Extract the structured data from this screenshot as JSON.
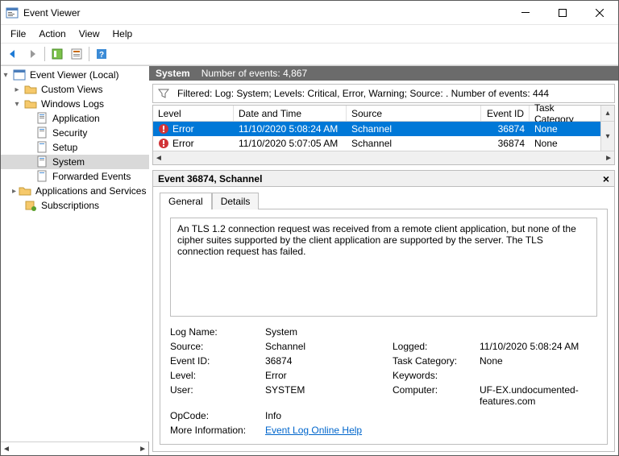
{
  "window": {
    "title": "Event Viewer"
  },
  "menu": {
    "file": "File",
    "action": "Action",
    "view": "View",
    "help": "Help"
  },
  "tree": {
    "root": "Event Viewer (Local)",
    "custom_views": "Custom Views",
    "windows_logs": "Windows Logs",
    "application": "Application",
    "security": "Security",
    "setup": "Setup",
    "system": "System",
    "forwarded": "Forwarded Events",
    "apps_logs": "Applications and Services Lo",
    "subscriptions": "Subscriptions"
  },
  "section": {
    "name": "System",
    "count_label": "Number of events: 4,867"
  },
  "filter_text": "Filtered: Log: System; Levels: Critical, Error, Warning; Source: . Number of events: 444",
  "table": {
    "headers": {
      "level": "Level",
      "date": "Date and Time",
      "source": "Source",
      "event_id": "Event ID",
      "task_cat": "Task Category"
    },
    "rows": [
      {
        "level": "Error",
        "date": "11/10/2020 5:08:24 AM",
        "source": "Schannel",
        "event_id": "36874",
        "task_cat": "None",
        "selected": true
      },
      {
        "level": "Error",
        "date": "11/10/2020 5:07:05 AM",
        "source": "Schannel",
        "event_id": "36874",
        "task_cat": "None",
        "selected": false
      }
    ]
  },
  "detail": {
    "title": "Event 36874, Schannel",
    "tabs": {
      "general": "General",
      "details": "Details"
    },
    "message": "An TLS 1.2 connection request was received from a remote client application, but none of the cipher suites supported by the client application are supported by the server. The TLS connection request has failed.",
    "labels": {
      "log_name": "Log Name:",
      "source": "Source:",
      "logged": "Logged:",
      "event_id": "Event ID:",
      "task_cat": "Task Category:",
      "level": "Level:",
      "keywords": "Keywords:",
      "user": "User:",
      "computer": "Computer:",
      "opcode": "OpCode:",
      "more_info": "More Information:"
    },
    "values": {
      "log_name": "System",
      "source": "Schannel",
      "logged": "11/10/2020 5:08:24 AM",
      "event_id": "36874",
      "task_cat": "None",
      "level": "Error",
      "keywords": "",
      "user": "SYSTEM",
      "computer": "UF-EX.undocumented-features.com",
      "opcode": "Info",
      "more_info_link": "Event Log Online Help"
    }
  }
}
